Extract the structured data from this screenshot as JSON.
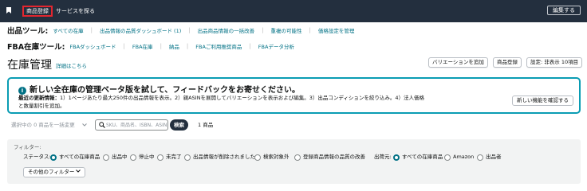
{
  "topbar": {
    "active_tab": "商品登録",
    "sell_tab": "サービスを探る",
    "edit_button": "編集する"
  },
  "tools": {
    "title": "出品ツール:",
    "links": [
      "すべての在庫",
      "出品情報の品質ダッシュボード (1)",
      "出品商品情報の一括改善",
      "重複の可能性",
      "価格設定を管理"
    ]
  },
  "fba_tools": {
    "title": "FBA在庫ツール:",
    "links": [
      "FBAダッシュボード",
      "FBA在庫",
      "納品",
      "FBAご利用推奨商品",
      "FBAデータ分析"
    ]
  },
  "page": {
    "title": "在庫管理",
    "details_link": "詳細はこちら",
    "buttons": {
      "add_variation": "バリエーションを追加",
      "add_product": "商品登録",
      "settings": "設定: 非表示 10項目"
    }
  },
  "banner": {
    "icon": "info-icon",
    "title": "新しい全在庫の管理ベータ版を試して、フィードバックをお寄せください。",
    "body_bold": "最近の更新情報：",
    "body": "1）1ページあたり最大250件の出品情報を表示。2）親ASINを展開してバリエーションを表示および編集。3）出品コンディションを絞り込み。4）法人価格と数量割引を追加。",
    "button": "新しい機能を確認する"
  },
  "search": {
    "bulk_select": "選択中の 0 商品を一括変更",
    "placeholder": "SKU、商品名、ISBN、ASIN",
    "button": "検索",
    "count": "1 商品"
  },
  "filters": {
    "label": "フィルター:",
    "status_label": "ステータス:",
    "status_options": [
      {
        "label": "すべての在庫商品",
        "selected": true
      },
      {
        "label": "出品中",
        "selected": false
      },
      {
        "label": "停止中",
        "selected": false
      },
      {
        "label": "未完了",
        "selected": false
      },
      {
        "label": "出品情報が削除されました",
        "selected": false
      },
      {
        "label": "検索対象外",
        "selected": false
      },
      {
        "label": "登録商品情報の品質の改善",
        "selected": false
      }
    ],
    "seller_label": "出荷元:",
    "seller_options": [
      {
        "label": "すべての在庫商品",
        "selected": true
      },
      {
        "label": "Amazon",
        "selected": false
      },
      {
        "label": "出品者",
        "selected": false
      }
    ],
    "more_filters": "その他のフィルター"
  },
  "colors": {
    "topbar": "#232f3e",
    "link": "#007185",
    "highlight": "#e3262f",
    "banner_border": "#0a9cb3"
  }
}
